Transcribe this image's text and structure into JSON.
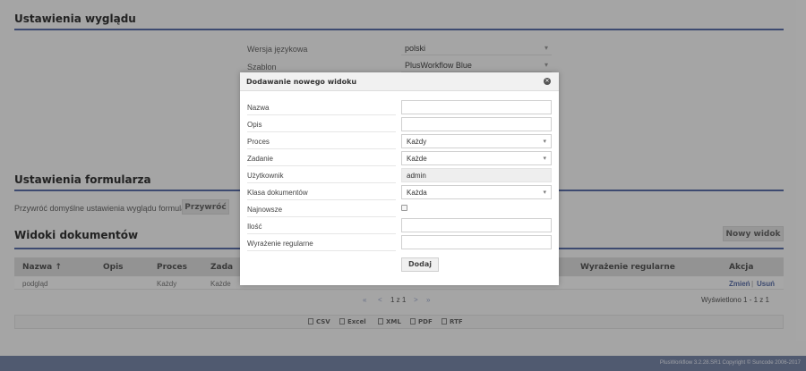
{
  "appearance": {
    "title": "Ustawienia wyglądu",
    "language_label": "Wersja językowa",
    "language_value": "polski",
    "template_label": "Szablon",
    "template_value": "PlusWorkflow Blue"
  },
  "form_settings": {
    "title": "Ustawienia formularza",
    "restore_text": "Przywróć domyślne ustawienia wyglądu formularza",
    "restore_button": "Przywróć"
  },
  "document_views": {
    "title": "Widoki dokumentów",
    "new_view_button": "Nowy widok",
    "columns": [
      "Nazwa ↑",
      "Opis",
      "Proces",
      "Zada",
      "Wyrażenie regularne",
      "Akcja"
    ],
    "row": {
      "name": "podgląd",
      "process": "Każdy",
      "task": "Każde",
      "edit": "Zmień",
      "separator": "|",
      "delete": "Usuń"
    },
    "pager": {
      "first": "«",
      "prev": "<",
      "pages": "1 z 1",
      "next": ">",
      "last": "»"
    },
    "displayed": "Wyświetlono 1 - 1 z 1",
    "exports": [
      "CSV",
      "Excel",
      "XML",
      "PDF",
      "RTF"
    ]
  },
  "footer": {
    "text": "PlusWorkflow 3.2.28.SR1 Copyright © Suncode 2006-2017"
  },
  "modal": {
    "title": "Dodawanie nowego widoku",
    "fields": {
      "name": {
        "label": "Nazwa",
        "value": ""
      },
      "description": {
        "label": "Opis",
        "value": ""
      },
      "process": {
        "label": "Proces",
        "value": "Każdy"
      },
      "task": {
        "label": "Zadanie",
        "value": "Każde"
      },
      "user": {
        "label": "Użytkownik",
        "value": "admin"
      },
      "doc_class": {
        "label": "Klasa dokumentów",
        "value": "Każda"
      },
      "newest": {
        "label": "Najnowsze",
        "checked": false
      },
      "count": {
        "label": "Ilość",
        "value": ""
      },
      "regex": {
        "label": "Wyrażenie regularne",
        "value": ""
      }
    },
    "submit_button": "Dodaj"
  }
}
